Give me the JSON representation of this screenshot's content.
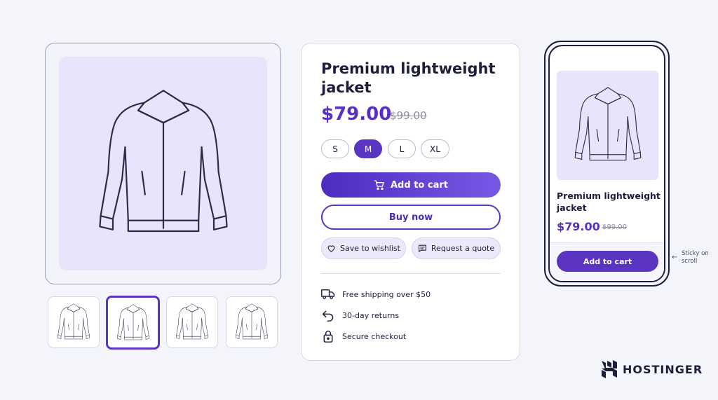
{
  "product": {
    "title": "Premium lightweight jacket",
    "price": "$79.00",
    "old_price": "$99.00",
    "sizes": [
      "S",
      "M",
      "L",
      "XL"
    ],
    "selected_size": "M",
    "add_to_cart_label": "Add to cart",
    "buy_now_label": "Buy now",
    "wishlist_label": "Save to wishlist",
    "quote_label": "Request a quote",
    "features": [
      "Free shipping over $50",
      "30-day returns",
      "Secure checkout"
    ]
  },
  "gallery": {
    "main_image_icon": "jacket-illustration",
    "thumbnail_count": 4,
    "selected_thumbnail": 2
  },
  "mobile_preview": {
    "title": "Premium lightweight jacket",
    "price": "$79.00",
    "old_price": "$99.00",
    "add_to_cart_label": "Add to cart",
    "sticky_note": "Sticky on scroll"
  },
  "brand": {
    "name": "HOSTINGER"
  },
  "colors": {
    "accent": "#5b34c2",
    "price": "#5a2fc2",
    "background": "#f4f4fb",
    "image_background": "#e7e4fb"
  }
}
